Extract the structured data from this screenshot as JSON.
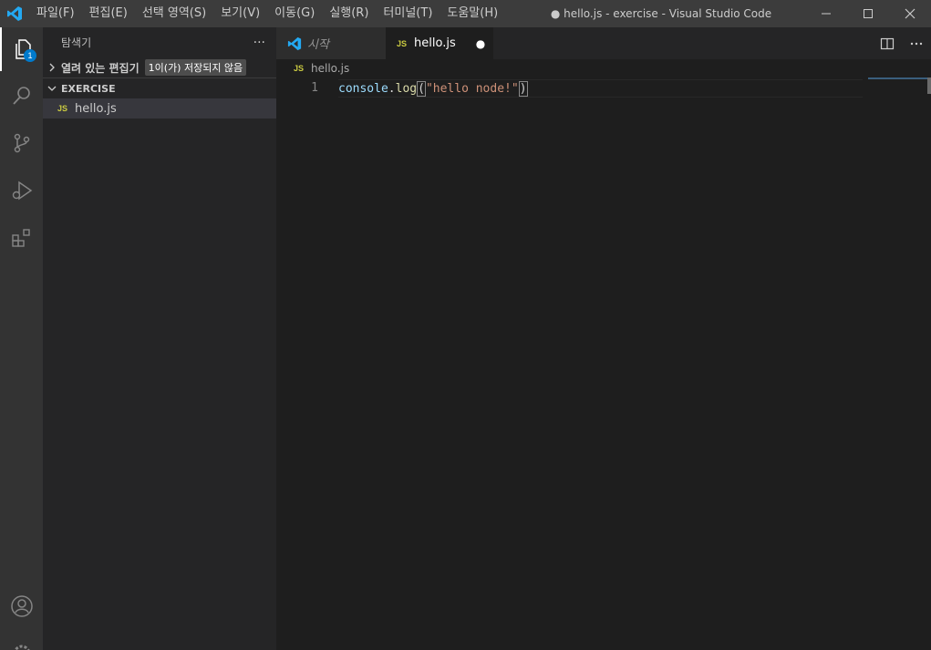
{
  "window": {
    "title": "● hello.js - exercise - Visual Studio Code"
  },
  "menu": [
    {
      "label": "파일(F)"
    },
    {
      "label": "편집(E)"
    },
    {
      "label": "선택 영역(S)"
    },
    {
      "label": "보기(V)"
    },
    {
      "label": "이동(G)"
    },
    {
      "label": "실행(R)"
    },
    {
      "label": "터미널(T)"
    },
    {
      "label": "도움말(H)"
    }
  ],
  "activity": {
    "explorer_badge": "1",
    "icons": [
      "explorer-icon",
      "search-icon",
      "source-control-icon",
      "run-debug-icon",
      "extensions-icon",
      "account-icon",
      "settings-gear-icon"
    ]
  },
  "sidebar": {
    "title": "탐색기",
    "more": "···",
    "open_editors": "열려 있는 편집기",
    "unsaved": "1이(가) 저장되지 않음",
    "folder": "EXERCISE",
    "file_icon": "JS",
    "file": "hello.js"
  },
  "tabs": [
    {
      "label": "시작",
      "icon": "vscode-logo-icon"
    },
    {
      "label": "hello.js",
      "icon": "JS",
      "dirty": "●"
    }
  ],
  "breadcrumb": {
    "icon": "JS",
    "file": "hello.js"
  },
  "editor": {
    "line_number": "1",
    "code": {
      "obj": "console",
      "dot": ".",
      "fn": "log",
      "open": "(",
      "str": "\"hello node!\"",
      "close": ")"
    }
  },
  "colors": {
    "accent": "#007acc",
    "titlebar": "#3c3c3c",
    "activitybar": "#333333",
    "sidebar": "#252526",
    "editor": "#1e1e1e"
  }
}
